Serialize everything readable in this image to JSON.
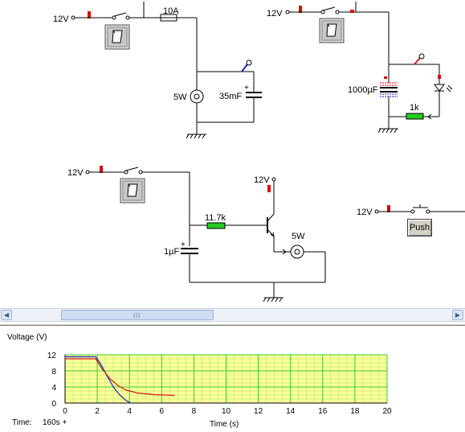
{
  "circuits": {
    "c1": {
      "supply": "12V",
      "fuse": "10A",
      "lamp": "5W",
      "capacitor": "35mF"
    },
    "c2": {
      "supply": "12V",
      "capacitor": "1000µF",
      "resistor": "1k"
    },
    "c3": {
      "supply": "12V",
      "resistor": "11.7k",
      "capacitor": "1µF",
      "transistor_supply": "12V",
      "lamp": "5W"
    },
    "c4": {
      "supply": "12V",
      "button": "Push"
    }
  },
  "colors": {
    "indicator_red": "#dd0000",
    "resistor_green": "#22cc22",
    "grid_bg": "#ffff99",
    "grid_line": "#33cc33",
    "series_blue": "#1f1fd6",
    "series_red": "#d01818"
  },
  "graph": {
    "title": "Voltage (V)",
    "x_label": "Time (s)",
    "time_label": "Time:",
    "time_value": "160s +"
  },
  "chart_data": {
    "type": "line",
    "ylabel": "Voltage (V)",
    "xlabel": "Time (s)",
    "xlim": [
      0,
      20
    ],
    "ylim": [
      0,
      12
    ],
    "x_ticks": [
      0,
      2,
      4,
      6,
      8,
      10,
      12,
      14,
      16,
      18,
      20
    ],
    "y_ticks": [
      0,
      4,
      8,
      12
    ],
    "grid": true,
    "series": [
      {
        "color": "#1f1fd6",
        "x": [
          0,
          1.9,
          2.2,
          2.6,
          3.0,
          3.4,
          3.8,
          4.1
        ],
        "y": [
          11.5,
          11.5,
          9.8,
          6.8,
          4.0,
          2.0,
          0.6,
          0.0
        ]
      },
      {
        "color": "#d01818",
        "x": [
          0,
          1.9,
          2.3,
          2.8,
          3.3,
          3.8,
          4.5,
          5.5,
          6.8
        ],
        "y": [
          11.0,
          11.0,
          8.5,
          6.0,
          4.3,
          3.2,
          2.5,
          2.1,
          1.9
        ]
      }
    ]
  }
}
